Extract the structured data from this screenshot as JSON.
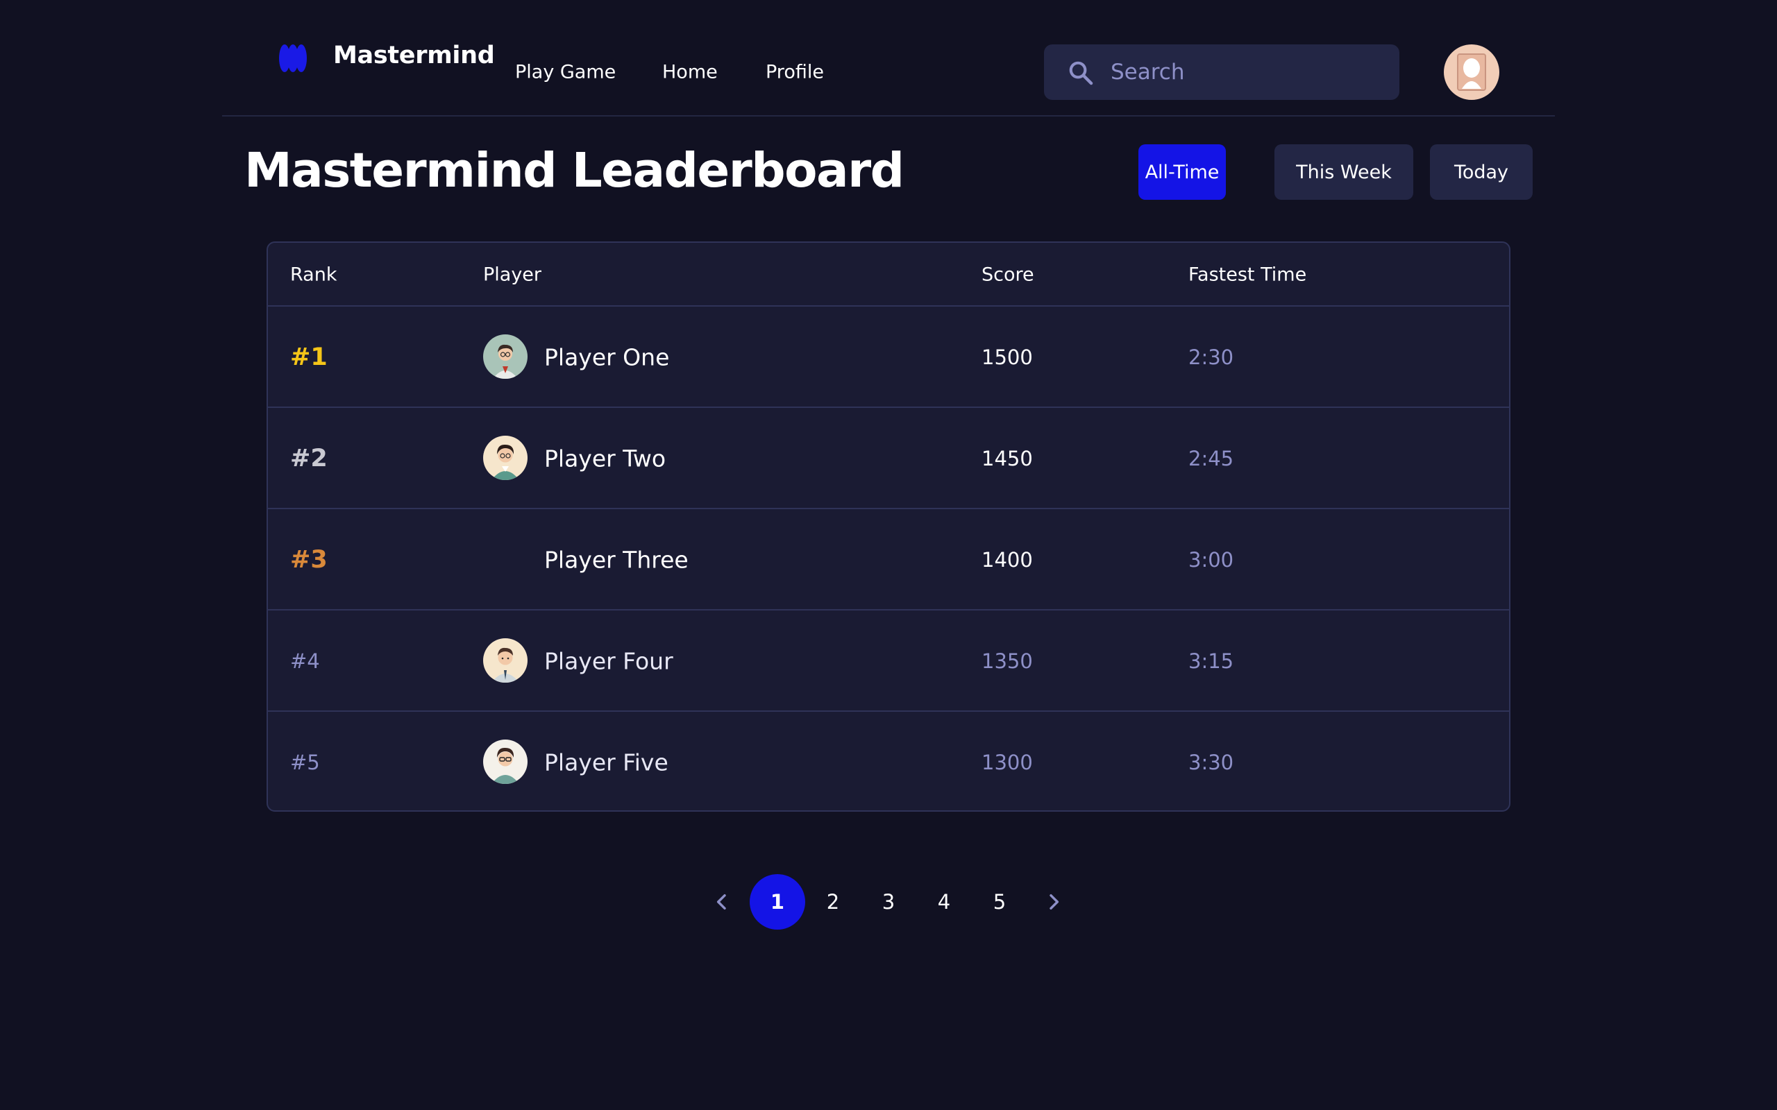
{
  "header": {
    "brand": "Mastermind",
    "nav": [
      "Play Game",
      "Home",
      "Profile"
    ],
    "search_placeholder": "Search"
  },
  "page": {
    "title": "Mastermind Leaderboard",
    "filters": [
      "All-Time",
      "This Week",
      "Today"
    ],
    "active_filter": "All-Time"
  },
  "table": {
    "columns": [
      "Rank",
      "Player",
      "Score",
      "Fastest Time"
    ],
    "rows": [
      {
        "rank": "#1",
        "player": "Player One",
        "score": "1500",
        "time": "2:30"
      },
      {
        "rank": "#2",
        "player": "Player Two",
        "score": "1450",
        "time": "2:45"
      },
      {
        "rank": "#3",
        "player": "Player Three",
        "score": "1400",
        "time": "3:00"
      },
      {
        "rank": "#4",
        "player": "Player Four",
        "score": "1350",
        "time": "3:15"
      },
      {
        "rank": "#5",
        "player": "Player Five",
        "score": "1300",
        "time": "3:30"
      }
    ]
  },
  "pagination": {
    "pages": [
      "1",
      "2",
      "3",
      "4",
      "5"
    ],
    "current": "1"
  },
  "colors": {
    "background": "#111122",
    "surface": "#1a1b33",
    "accent": "#1414e6",
    "gold": "#f5c518",
    "silver": "#c9c9d2",
    "bronze": "#d9893a",
    "muted": "#8e90c8"
  },
  "icons": {
    "logo": "mastermind-logo-icon",
    "search": "search-icon",
    "prev": "chevron-left-icon",
    "next": "chevron-right-icon"
  }
}
